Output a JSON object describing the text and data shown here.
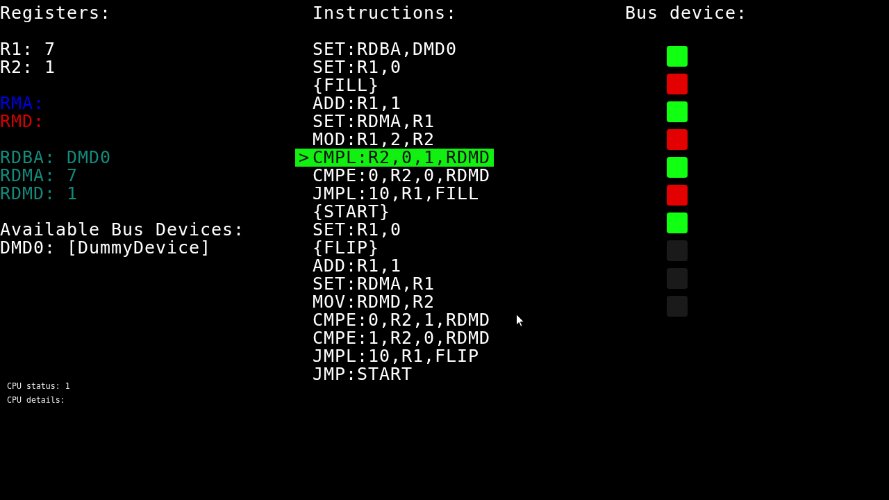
{
  "registers": {
    "title": "Registers:",
    "groups": [
      {
        "items": [
          {
            "text": "R1: 7",
            "color": "#ffffff"
          },
          {
            "text": "R2: 1",
            "color": "#ffffff"
          }
        ]
      },
      {
        "items": [
          {
            "text": "RMA:",
            "color": "#0000e6"
          },
          {
            "text": "RMD:",
            "color": "#d40000"
          }
        ]
      },
      {
        "items": [
          {
            "text": "RDBA: DMD0",
            "color": "#138a7a"
          },
          {
            "text": "RDMA: 7",
            "color": "#138a7a"
          },
          {
            "text": "RDMD: 1",
            "color": "#138a7a"
          }
        ]
      }
    ]
  },
  "available_devices": {
    "title": "Available Bus Devices:",
    "items": [
      "DMD0: [DummyDevice]"
    ]
  },
  "instructions": {
    "title": "Instructions:",
    "pointer": ">",
    "items": [
      {
        "text": "SET:RDBA,DMD0",
        "selected": false
      },
      {
        "text": "SET:R1,0",
        "selected": false
      },
      {
        "text": "{FILL}",
        "selected": false
      },
      {
        "text": "ADD:R1,1",
        "selected": false
      },
      {
        "text": "SET:RDMA,R1",
        "selected": false
      },
      {
        "text": "MOD:R1,2,R2",
        "selected": false
      },
      {
        "text": "CMPL:R2,0,1,RDMD",
        "selected": true
      },
      {
        "text": "CMPE:0,R2,0,RDMD",
        "selected": false
      },
      {
        "text": "JMPL:10,R1,FILL",
        "selected": false
      },
      {
        "text": "{START}",
        "selected": false
      },
      {
        "text": "SET:R1,0",
        "selected": false
      },
      {
        "text": "{FLIP}",
        "selected": false
      },
      {
        "text": "ADD:R1,1",
        "selected": false
      },
      {
        "text": "SET:RDMA,R1",
        "selected": false
      },
      {
        "text": "MOV:RDMD,R2",
        "selected": false
      },
      {
        "text": "CMPE:0,R2,1,RDMD",
        "selected": false
      },
      {
        "text": "CMPE:1,R2,0,RDMD",
        "selected": false
      },
      {
        "text": "JMPL:10,R1,FLIP",
        "selected": false
      },
      {
        "text": "JMP:START",
        "selected": false
      }
    ]
  },
  "bus_device": {
    "title": "Bus device:",
    "cells": [
      {
        "color": "#11ff11"
      },
      {
        "color": "#e20000"
      },
      {
        "color": "#11ff11"
      },
      {
        "color": "#e20000"
      },
      {
        "color": "#11ff11"
      },
      {
        "color": "#e20000"
      },
      {
        "color": "#11ff11"
      },
      {
        "color": "#1a1a1a"
      },
      {
        "color": "#1a1a1a"
      },
      {
        "color": "#1a1a1a"
      }
    ]
  },
  "cpu": {
    "status": "CPU status: 1",
    "details": "CPU details:"
  }
}
